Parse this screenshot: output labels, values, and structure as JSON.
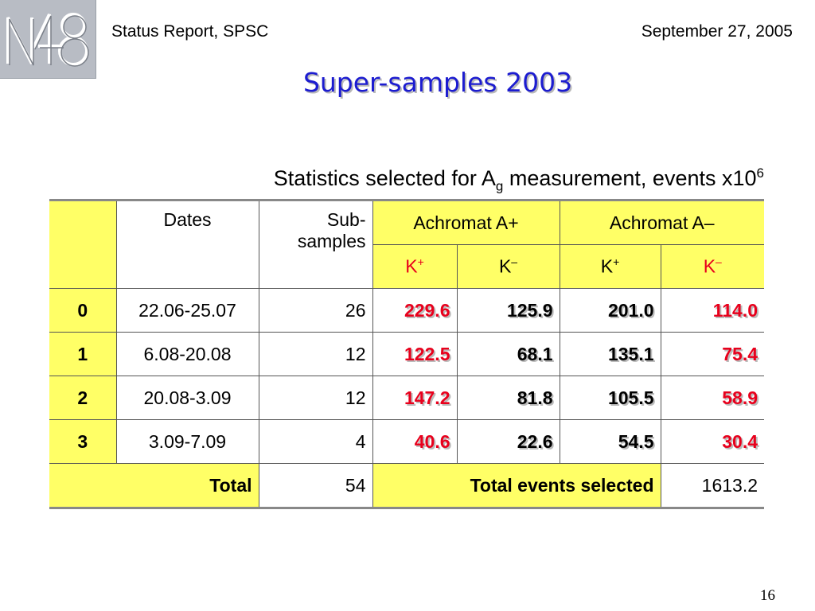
{
  "header": {
    "left": "Status Report, SPSC",
    "right": "September 27, 2005"
  },
  "title": "Super-samples 2003",
  "subtitle": {
    "prefix": "Statistics selected for A",
    "sub": "g",
    "middle": " measurement, events x10",
    "sup": "6"
  },
  "table": {
    "headers": {
      "dates": "Dates",
      "subsamples": "Sub-samples",
      "achromat_plus": "Achromat A+",
      "achromat_minus": "Achromat A–",
      "k_plus_1": "K",
      "k_minus_1": "K",
      "k_plus_2": "K",
      "k_minus_2": "K",
      "plus_sign": "+",
      "minus_sign": "–"
    },
    "rows": [
      {
        "id": "0",
        "dates": "22.06-25.07",
        "sub": "26",
        "ap_kp": "229.6",
        "ap_km": "125.9",
        "am_kp": "201.0",
        "am_km": "114.0"
      },
      {
        "id": "1",
        "dates": "6.08-20.08",
        "sub": "12",
        "ap_kp": "122.5",
        "ap_km": "68.1",
        "am_kp": "135.1",
        "am_km": "75.4"
      },
      {
        "id": "2",
        "dates": "20.08-3.09",
        "sub": "12",
        "ap_kp": "147.2",
        "ap_km": "81.8",
        "am_kp": "105.5",
        "am_km": "58.9"
      },
      {
        "id": "3",
        "dates": "3.09-7.09",
        "sub": "4",
        "ap_kp": "40.6",
        "ap_km": "22.6",
        "am_kp": "54.5",
        "am_km": "30.4"
      }
    ],
    "total": {
      "label": "Total",
      "sub": "54",
      "events_label": "Total events selected",
      "events_value": "1613.2"
    }
  },
  "page_number": "16",
  "logo_text": "NA48",
  "colors": {
    "title": "#1c1cd0",
    "highlight": "#ffff66",
    "red": "#e8001c"
  }
}
